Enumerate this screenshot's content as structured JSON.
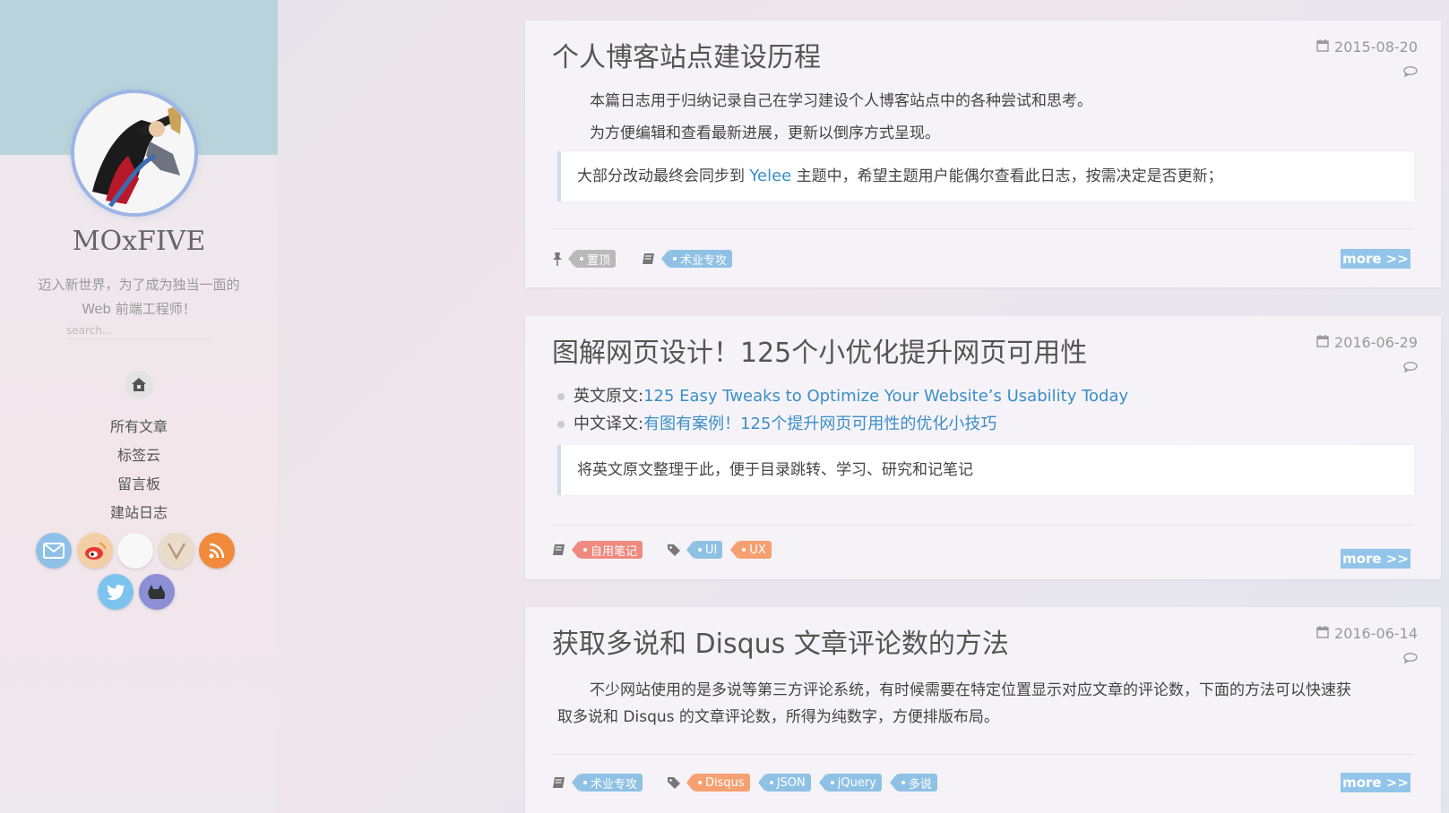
{
  "sidebar": {
    "site_name": "MOxFIVE",
    "motto_line1": "迈入新世界，为了成为独当一面的",
    "motto_line2": "Web 前端工程师！",
    "search_placeholder": "search...",
    "nav": [
      "所有文章",
      "标签云",
      "留言板",
      "建站日志"
    ],
    "social_icons": [
      "email-icon",
      "weibo-icon",
      "github-icon",
      "v2ex-icon",
      "rss-icon",
      "twitter-icon",
      "cat-icon"
    ]
  },
  "posts": [
    {
      "title": "个人博客站点建设历程",
      "date": "2015-08-20",
      "p1": "本篇日志用于归纳记录自己在学习建设个人博客站点中的各种尝试和思考。",
      "p2": "为方便编辑和查看最新进展，更新以倒序方式呈现。",
      "quote_before": "大部分改动最终会同步到 ",
      "quote_link": "Yelee",
      "quote_after": " 主题中，希望主题用户能偶尔查看此日志，按需决定是否更新；",
      "tag_top": "置顶",
      "category": "术业专攻",
      "more": "more >>"
    },
    {
      "title": "图解网页设计！125个小优化提升网页可用性",
      "date": "2016-06-29",
      "item1_label": "英文原文: ",
      "item1_link": "125 Easy Tweaks to Optimize Your Website’s Usability Today",
      "item2_label": "中文译文: ",
      "item2_link": "有图有案例！125个提升网页可用性的优化小技巧",
      "quote": "将英文原文整理于此，便于目录跳转、学习、研究和记笔记",
      "category": "自用笔记",
      "tags": [
        "UI",
        "UX"
      ],
      "more": "more >>"
    },
    {
      "title": "获取多说和 Disqus 文章评论数的方法",
      "date": "2016-06-14",
      "p1": "不少网站使用的是多说等第三方评论系统，有时候需要在特定位置显示对应文章的评论数，下面的方法可以快速获",
      "p2": "取多说和 Disqus 的文章评论数，所得为纯数字，方便排版布局。",
      "category": "术业专攻",
      "tags": [
        "Disqus",
        "JSON",
        "jQuery",
        "多说"
      ],
      "more": "more >>"
    }
  ],
  "colors": {
    "accent": "#93c5ea",
    "link": "#3a8fc7",
    "tag_gray": "#b9b9b9",
    "tag_blue": "#8fc1e4",
    "tag_red": "#ef8a80",
    "tag_orange": "#f6a072"
  }
}
